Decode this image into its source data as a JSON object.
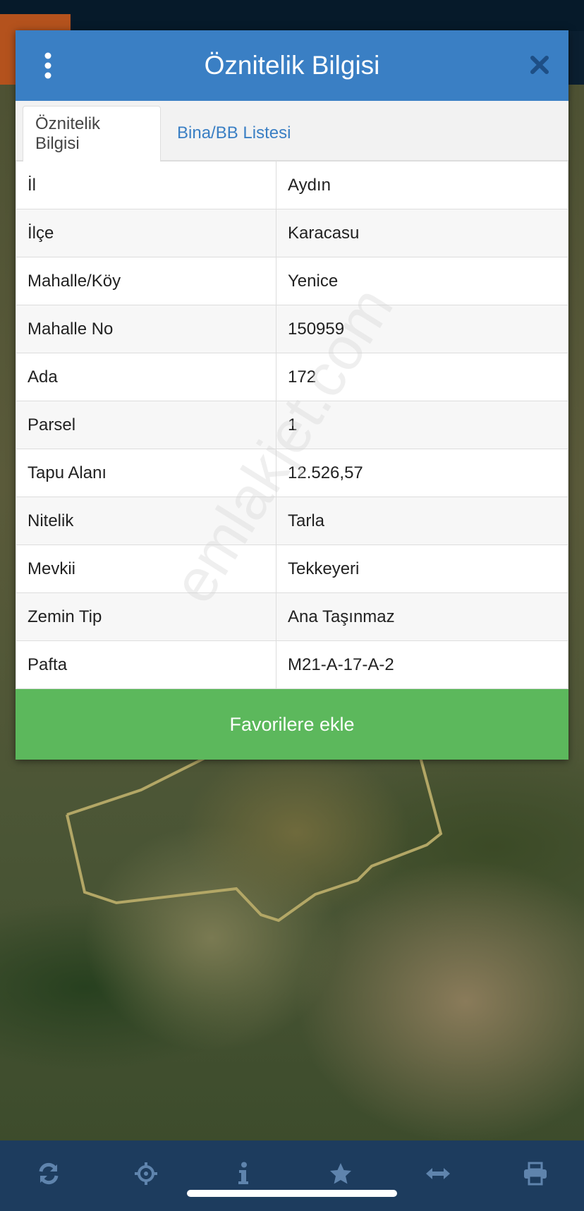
{
  "dialog": {
    "title": "Öznitelik Bilgisi",
    "tabs": [
      {
        "label": "Öznitelik Bilgisi",
        "active": true
      },
      {
        "label": "Bina/BB Listesi",
        "active": false
      }
    ],
    "rows": [
      {
        "key": "İl",
        "value": "Aydın"
      },
      {
        "key": "İlçe",
        "value": "Karacasu"
      },
      {
        "key": "Mahalle/Köy",
        "value": "Yenice"
      },
      {
        "key": "Mahalle No",
        "value": "150959"
      },
      {
        "key": "Ada",
        "value": "172"
      },
      {
        "key": "Parsel",
        "value": "1"
      },
      {
        "key": "Tapu Alanı",
        "value": "12.526,57"
      },
      {
        "key": "Nitelik",
        "value": "Tarla"
      },
      {
        "key": "Mevkii",
        "value": "Tekkeyeri"
      },
      {
        "key": "Zemin Tip",
        "value": "Ana Taşınmaz"
      },
      {
        "key": "Pafta",
        "value": "M21-A-17-A-2"
      }
    ],
    "favorite_button_label": "Favorilere ekle"
  },
  "watermark": "emlakjet.com",
  "toolbar": {
    "icons": [
      "refresh-icon",
      "locate-crosshair-icon",
      "info-icon",
      "star-icon",
      "measure-arrows-icon",
      "print-icon"
    ]
  },
  "colors": {
    "header": "#3a7fc4",
    "button": "#5cb85c",
    "toolbar": "#1d3c5e",
    "parcel_outline": "#b3a766"
  }
}
